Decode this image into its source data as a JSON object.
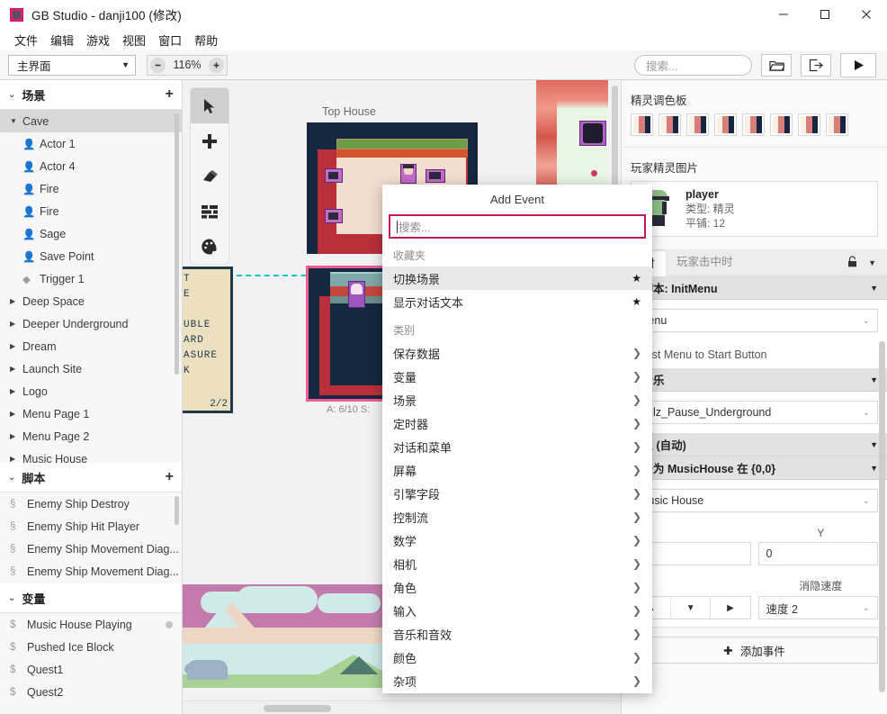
{
  "window": {
    "title": "GB Studio - danji100 (修改)",
    "minimize": "–",
    "maximize": "□",
    "close": "✕"
  },
  "menubar": {
    "items": [
      "文件",
      "编辑",
      "游戏",
      "视图",
      "窗口",
      "帮助"
    ]
  },
  "toolbar": {
    "view_select": "主界面",
    "zoom_out": "–",
    "zoom_value": "116%",
    "zoom_in": "+",
    "search_placeholder": "搜索...",
    "folder_button": "folder-icon",
    "export_button": "export-icon",
    "play_button": "play-icon"
  },
  "sidebar": {
    "scenes_header": "场景",
    "scenes_add": "+",
    "scenes": [
      {
        "label": "Cave",
        "type": "folder",
        "expanded": true,
        "selected": true
      },
      {
        "label": "Actor 1",
        "type": "actor"
      },
      {
        "label": "Actor 4",
        "type": "actor"
      },
      {
        "label": "Fire",
        "type": "actor"
      },
      {
        "label": "Fire",
        "type": "actor"
      },
      {
        "label": "Sage",
        "type": "actor"
      },
      {
        "label": "Save Point",
        "type": "actor"
      },
      {
        "label": "Trigger 1",
        "type": "trigger"
      },
      {
        "label": "Deep Space",
        "type": "folder"
      },
      {
        "label": "Deeper Underground",
        "type": "folder"
      },
      {
        "label": "Dream",
        "type": "folder"
      },
      {
        "label": "Launch Site",
        "type": "folder"
      },
      {
        "label": "Logo",
        "type": "folder"
      },
      {
        "label": "Menu Page 1",
        "type": "folder"
      },
      {
        "label": "Menu Page 2",
        "type": "folder"
      },
      {
        "label": "Music House",
        "type": "folder"
      }
    ],
    "scripts_header": "脚本",
    "scripts_add": "+",
    "scripts": [
      "Enemy Ship Destroy",
      "Enemy Ship Hit Player",
      "Enemy Ship Movement Diag...",
      "Enemy Ship Movement Diag..."
    ],
    "variables_header": "变量",
    "variables": [
      "Music House Playing",
      "Pushed Ice Block",
      "Quest1",
      "Quest2"
    ]
  },
  "canvas": {
    "tools": [
      {
        "name": "select-tool",
        "glyph": "➤",
        "active": true
      },
      {
        "name": "add-tool",
        "glyph": "+"
      },
      {
        "name": "eraser-tool",
        "glyph": "◣"
      },
      {
        "name": "collision-tool",
        "glyph": "▤"
      },
      {
        "name": "palette-tool",
        "glyph": "◕"
      }
    ],
    "scene_labels": [
      {
        "name": "Top House"
      }
    ],
    "scene_stats": "A: 6/10   S:"
  },
  "right_panel": {
    "sprite_palette_title": "精灵调色板",
    "palette_colors": [
      "#f7f0e3",
      "#d97f7a",
      "#142641"
    ],
    "palette_count": 8,
    "player_sprite_title": "玩家精灵图片",
    "sprite": {
      "name": "player",
      "type_label": "类型: 精灵",
      "tiles_label": "平铺: 12"
    },
    "tabs": [
      {
        "label": "比时",
        "active": true
      },
      {
        "label": "玩家击中时",
        "active": false
      }
    ],
    "tab_lock_icon": "lock-icon",
    "tab_caret": "▼",
    "script_strip": "用脚本: InitMenu",
    "script_field": "Menu",
    "note_row": "Quest Menu to Start Button",
    "music_strip": "放音乐",
    "music_field": "Rulz_Pause_Underground",
    "fade_strip": "淡入 (自动)",
    "scene_strip": "场景为 MusicHouse 在 {0,0}",
    "scene_field": "Music House",
    "y_label": "Y",
    "y_value": "0",
    "fade_speed_label": "消隐速度",
    "fade_speed_value": "速度 2",
    "direction_buttons": [
      "▲",
      "▼",
      "▶"
    ],
    "add_event_label": "添加事件",
    "add_event_plus": "✚"
  },
  "dialog": {
    "title": "Add Event",
    "search_placeholder": "搜索...",
    "favorites_label": "收藏夹",
    "favorites": [
      {
        "label": "切换场景",
        "starred": true,
        "highlighted": true
      },
      {
        "label": "显示对话文本",
        "starred": true,
        "highlighted": false
      }
    ],
    "categories_label": "类别",
    "categories": [
      "保存数据",
      "变量",
      "场景",
      "定时器",
      "对话和菜单",
      "屏幕",
      "引擎字段",
      "控制流",
      "数学",
      "相机",
      "角色",
      "输入",
      "音乐和音效",
      "颜色",
      "杂项"
    ],
    "chevron": "❯"
  },
  "colors": {
    "accent_pink": "#c2185b",
    "selection_gray": "#d8d8d8",
    "connection_cyan": "#12c0d8"
  }
}
